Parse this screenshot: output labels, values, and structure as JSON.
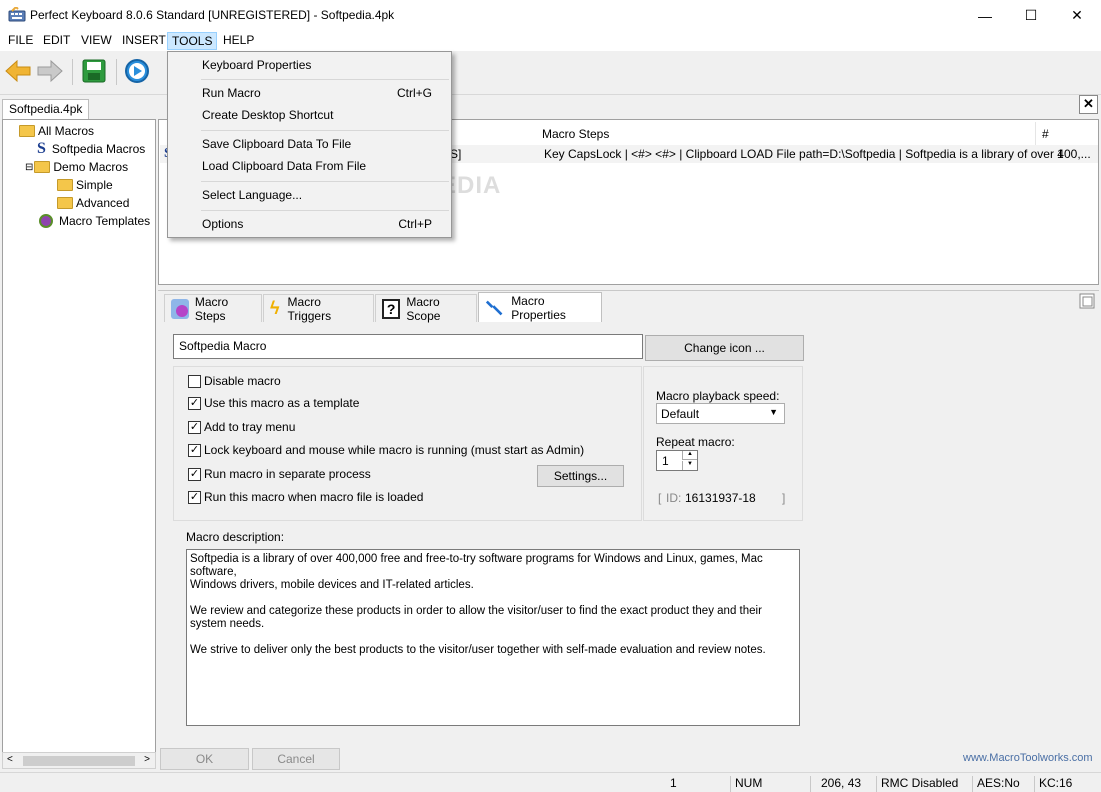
{
  "window": {
    "title": "Perfect Keyboard 8.0.6 Standard [UNREGISTERED] - Softpedia.4pk",
    "minimize": "—",
    "maximize": "☐",
    "close": "✕"
  },
  "menubar": [
    "FILE",
    "EDIT",
    "VIEW",
    "INSERT",
    "TOOLS",
    "HELP"
  ],
  "tools_menu": {
    "items": [
      {
        "label": "Keyboard Properties",
        "shortcut": ""
      },
      {
        "label": "Run Macro",
        "shortcut": "Ctrl+G"
      },
      {
        "label": "Create Desktop Shortcut",
        "shortcut": ""
      },
      {
        "label": "Save Clipboard Data To File",
        "shortcut": ""
      },
      {
        "label": "Load Clipboard Data From File",
        "shortcut": ""
      },
      {
        "label": "Select Language...",
        "shortcut": ""
      },
      {
        "label": "Options",
        "shortcut": "Ctrl+P"
      }
    ]
  },
  "doc_tab": "Softpedia.4pk",
  "tree": {
    "items": [
      "All Macros",
      "Softpedia Macros",
      "Demo Macros",
      "Simple",
      "Advanced",
      "Macro Templates"
    ]
  },
  "macro_list": {
    "columns": [
      "Macro Steps",
      "#"
    ],
    "row": {
      "name_fragment": "S]",
      "steps": "Key CapsLock | <#> <#> | Clipboard LOAD File path=D:\\Softpedia | Softpedia is a library of over 400,...",
      "count": "1"
    }
  },
  "prop_tabs": [
    "Macro Steps",
    "Macro Triggers",
    "Macro Scope",
    "Macro Properties"
  ],
  "props": {
    "macro_name": "Softpedia Macro",
    "change_icon": "Change icon ...",
    "checkboxes": [
      {
        "label": "Disable macro",
        "checked": false
      },
      {
        "label": "Use this macro as a template",
        "checked": true
      },
      {
        "label": "Add to tray menu",
        "checked": true
      },
      {
        "label": "Lock keyboard and mouse while macro is running (must start as Admin)",
        "checked": true
      },
      {
        "label": "Run macro in separate process",
        "checked": true
      },
      {
        "label": "Run this macro when macro file is loaded",
        "checked": true
      }
    ],
    "settings_btn": "Settings...",
    "playback_label": "Macro playback speed:",
    "playback_value": "Default",
    "repeat_label": "Repeat macro:",
    "repeat_value": "1",
    "id_label": "ID:",
    "id_value": "16131937-18",
    "id_open": "[",
    "id_close": "]",
    "description_label": "Macro description:",
    "description_lines": [
      "Softpedia is a library of over 400,000 free and free-to-try software programs for Windows and Linux, games, Mac software,",
      "Windows drivers, mobile devices and IT-related articles.",
      "",
      "We review and categorize these products in order to allow the visitor/user to find the exact product they and their system needs.",
      "",
      "We strive to deliver only the best products to the visitor/user together with self-made evaluation and review notes."
    ],
    "ok": "OK",
    "cancel": "Cancel",
    "website": "www.MacroToolworks.com"
  },
  "status": {
    "count": "1",
    "num": "NUM",
    "pos": "206, 43",
    "rmc": "RMC Disabled",
    "aes": "AES:No",
    "kc": "KC:16"
  },
  "watermark": "SOFTPEDIA",
  "colors": {
    "menu_active_bg": "#cce8ff",
    "folder": "#f4c64a",
    "link": "#4a6fa5"
  }
}
